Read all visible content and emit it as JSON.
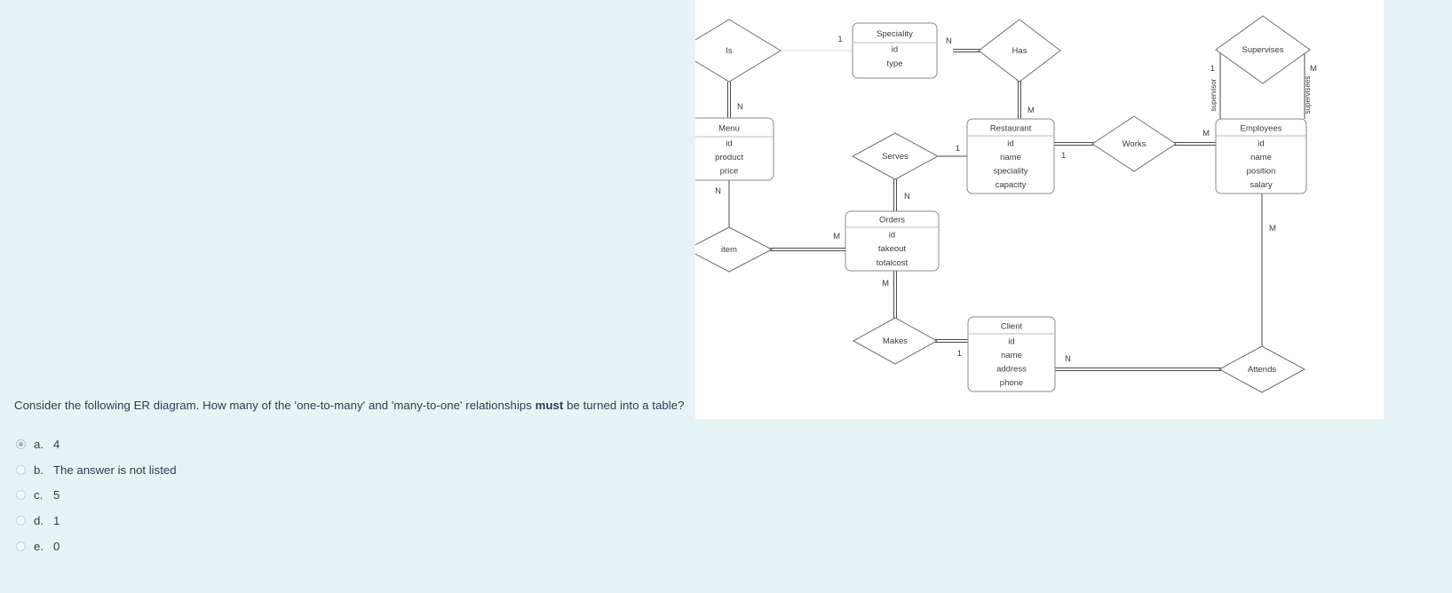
{
  "question": {
    "text_before": "Consider the following ER diagram. How many of the 'one-to-many' and 'many-to-one' relationships ",
    "emphasis": "must",
    "text_after": " be turned into a table?"
  },
  "answers": [
    {
      "letter": "a.",
      "label": "4",
      "selected": true
    },
    {
      "letter": "b.",
      "label": "The answer is not listed",
      "selected": false
    },
    {
      "letter": "c.",
      "label": "5",
      "selected": false
    },
    {
      "letter": "d.",
      "label": "1",
      "selected": false
    },
    {
      "letter": "e.",
      "label": "0",
      "selected": false
    }
  ],
  "diagram": {
    "entities": [
      {
        "id": "speciality",
        "title": "Speciality",
        "attrs": [
          "id",
          "type"
        ]
      },
      {
        "id": "menu",
        "title": "Menu",
        "attrs": [
          "id",
          "product",
          "price"
        ]
      },
      {
        "id": "restaurant",
        "title": "Restaurant",
        "attrs": [
          "id",
          "name",
          "speciality",
          "capacity"
        ]
      },
      {
        "id": "employees",
        "title": "Employees",
        "attrs": [
          "id",
          "name",
          "position",
          "salary"
        ]
      },
      {
        "id": "orders",
        "title": "Orders",
        "attrs": [
          "id",
          "takeout",
          "totalcost"
        ]
      },
      {
        "id": "client",
        "title": "Client",
        "attrs": [
          "id",
          "name",
          "address",
          "phone"
        ]
      }
    ],
    "relationships": [
      {
        "id": "is",
        "label": "Is"
      },
      {
        "id": "has",
        "label": "Has"
      },
      {
        "id": "supervises",
        "label": "Supervises"
      },
      {
        "id": "serves",
        "label": "Serves"
      },
      {
        "id": "works",
        "label": "Works"
      },
      {
        "id": "item",
        "label": "item"
      },
      {
        "id": "makes",
        "label": "Makes"
      },
      {
        "id": "attends",
        "label": "Attends"
      }
    ],
    "cardinalities": {
      "is_speciality": "1",
      "is_menu": "N",
      "has_speciality": "N",
      "has_restaurant": "M",
      "serves_restaurant": "1",
      "serves_orders": "N",
      "works_restaurant": "1",
      "works_employees": "M",
      "supervises_supervisor": "1",
      "supervises_supervisees": "M",
      "item_menu": "N",
      "item_orders": "M",
      "makes_orders": "M",
      "makes_client": "1",
      "attends_employees": "M",
      "attends_client": "N"
    },
    "roles": {
      "supervisor": "supervisor",
      "supervisees": "supervisees"
    }
  },
  "colors": {
    "page_background": "#e7f4f5",
    "panel_background": "#ffffff",
    "text": "#2b3d4f",
    "diagram_stroke": "#4a4a4a"
  }
}
